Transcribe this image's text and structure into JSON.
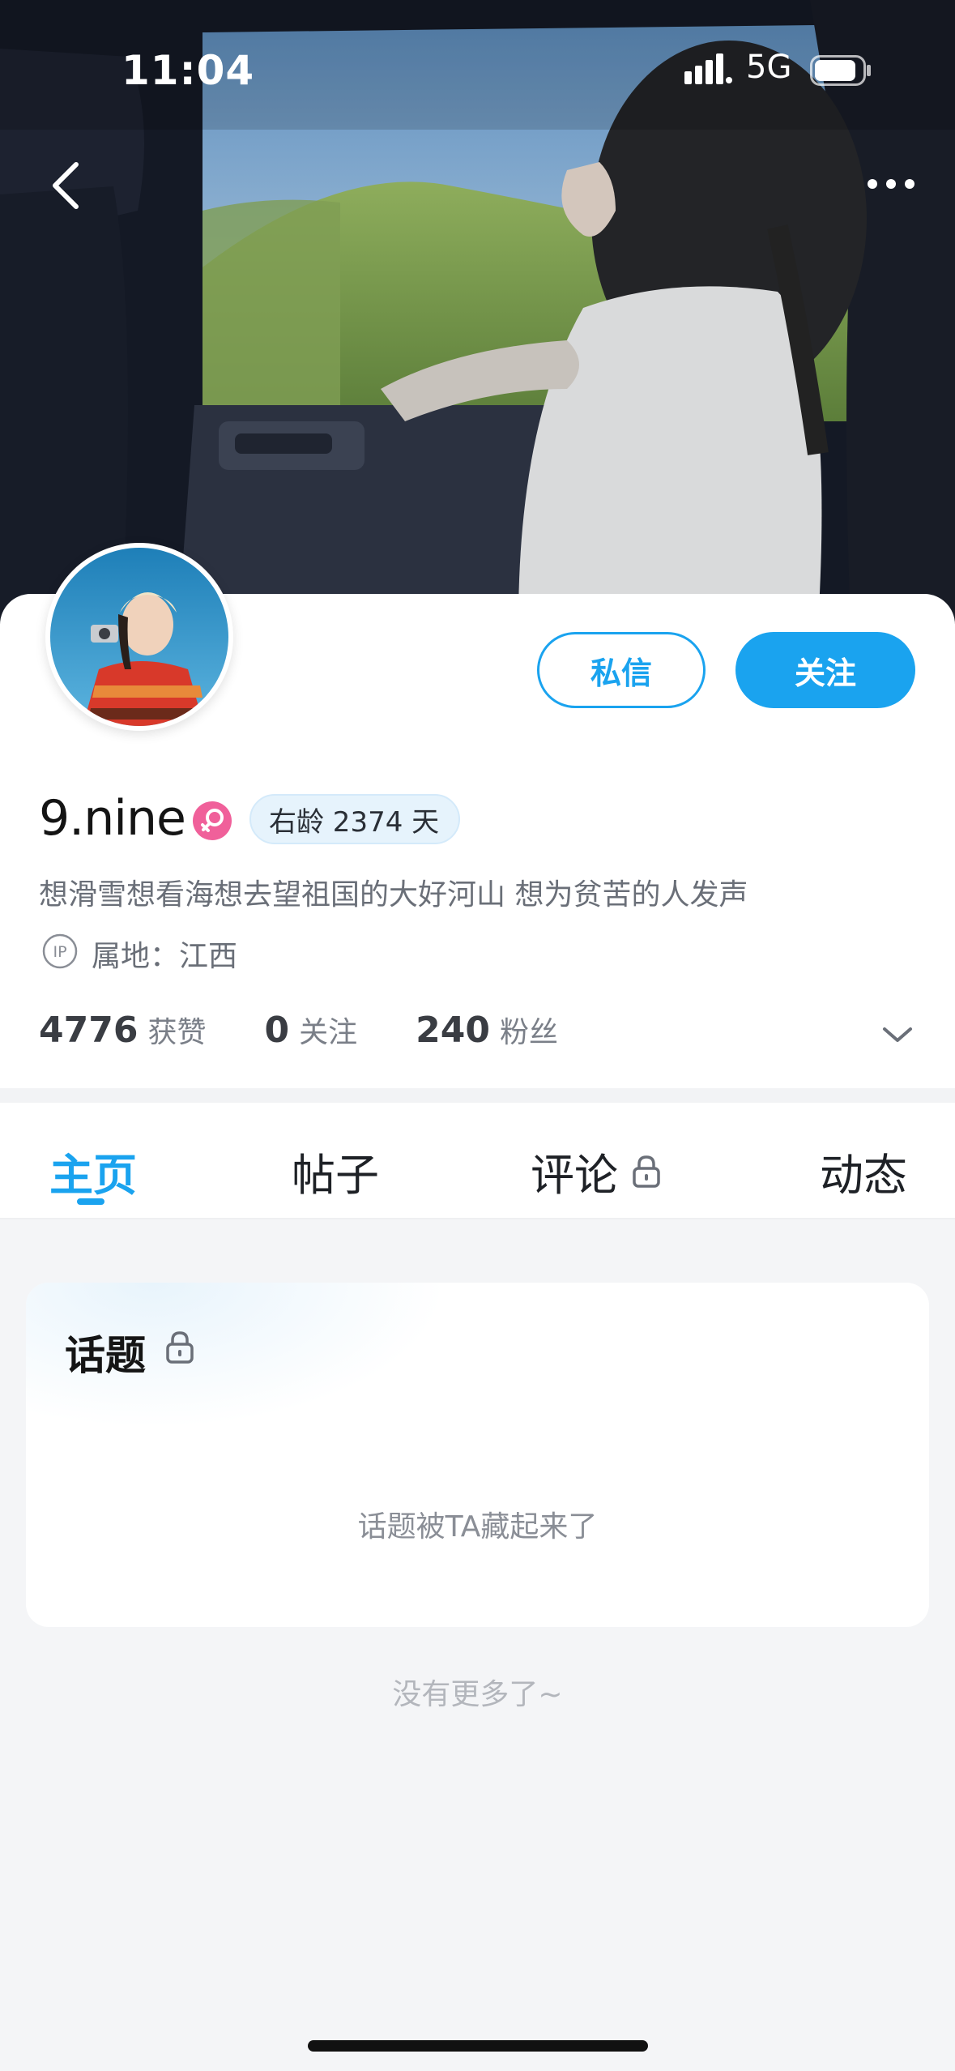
{
  "status_bar": {
    "time": "11:04",
    "network": "5G"
  },
  "profile": {
    "name": "9.nine",
    "age_badge": "右龄 2374 天",
    "bio": "想滑雪想看海想去望祖国的大好河山 想为贫苦的人发声",
    "location": "属地：江西",
    "ip_label": "IP"
  },
  "actions": {
    "message": "私信",
    "follow": "关注"
  },
  "stats": [
    {
      "value": "4776",
      "label": "获赞"
    },
    {
      "value": "0",
      "label": "关注"
    },
    {
      "value": "240",
      "label": "粉丝"
    }
  ],
  "tabs": [
    {
      "label": "主页",
      "active": true
    },
    {
      "label": "帖子",
      "active": false
    },
    {
      "label": "评论",
      "active": false,
      "locked": true
    },
    {
      "label": "动态",
      "active": false
    }
  ],
  "topic_card": {
    "title": "话题",
    "empty_text": "话题被TA藏起来了"
  },
  "footer": {
    "no_more": "没有更多了~"
  },
  "colors": {
    "accent": "#1aa3ef",
    "gender_badge": "#f0609a"
  },
  "icons": [
    "back-arrow-icon",
    "more-icon",
    "signal-icon",
    "battery-icon",
    "female-icon",
    "ip-icon",
    "chevron-down-icon",
    "lock-icon"
  ]
}
